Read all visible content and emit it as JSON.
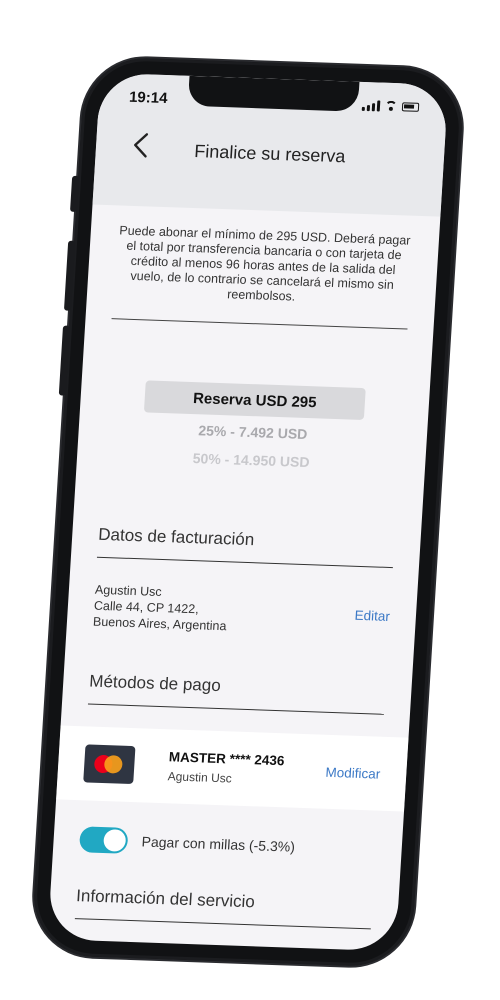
{
  "status_bar": {
    "time": "19:14"
  },
  "header": {
    "title": "Finalice su reserva"
  },
  "notice": "Puede abonar el mínimo de 295 USD. Deberá pagar el total por transferencia bancaria o con tarjeta de crédito al menos 96 horas antes de la salida del vuelo, de lo contrario se cancelará el mismo sin reembolsos.",
  "payment_options": [
    {
      "label": "Reserva USD 295",
      "selected": true
    },
    {
      "label": "25% - 7.492 USD",
      "selected": false
    },
    {
      "label": "50% - 14.950 USD",
      "selected": false
    }
  ],
  "billing": {
    "section_title": "Datos de facturación",
    "name": "Agustin Usc",
    "address_line1": "Calle 44, CP 1422,",
    "address_line2": "Buenos Aires, Argentina",
    "edit_label": "Editar"
  },
  "payment_methods": {
    "section_title": "Métodos de pago",
    "card_name": "MASTER **** 2436",
    "card_holder": "Agustin Usc",
    "modify_label": "Modificar"
  },
  "miles_toggle": {
    "label": "Pagar con millas (-5.3%)",
    "on": true
  },
  "service_info": {
    "section_title": "Información del servicio"
  },
  "colors": {
    "accent_link": "#3c79c6",
    "toggle_on": "#21a8c3",
    "header_bg": "#e8e9ec",
    "screen_bg": "#f5f4f7"
  }
}
